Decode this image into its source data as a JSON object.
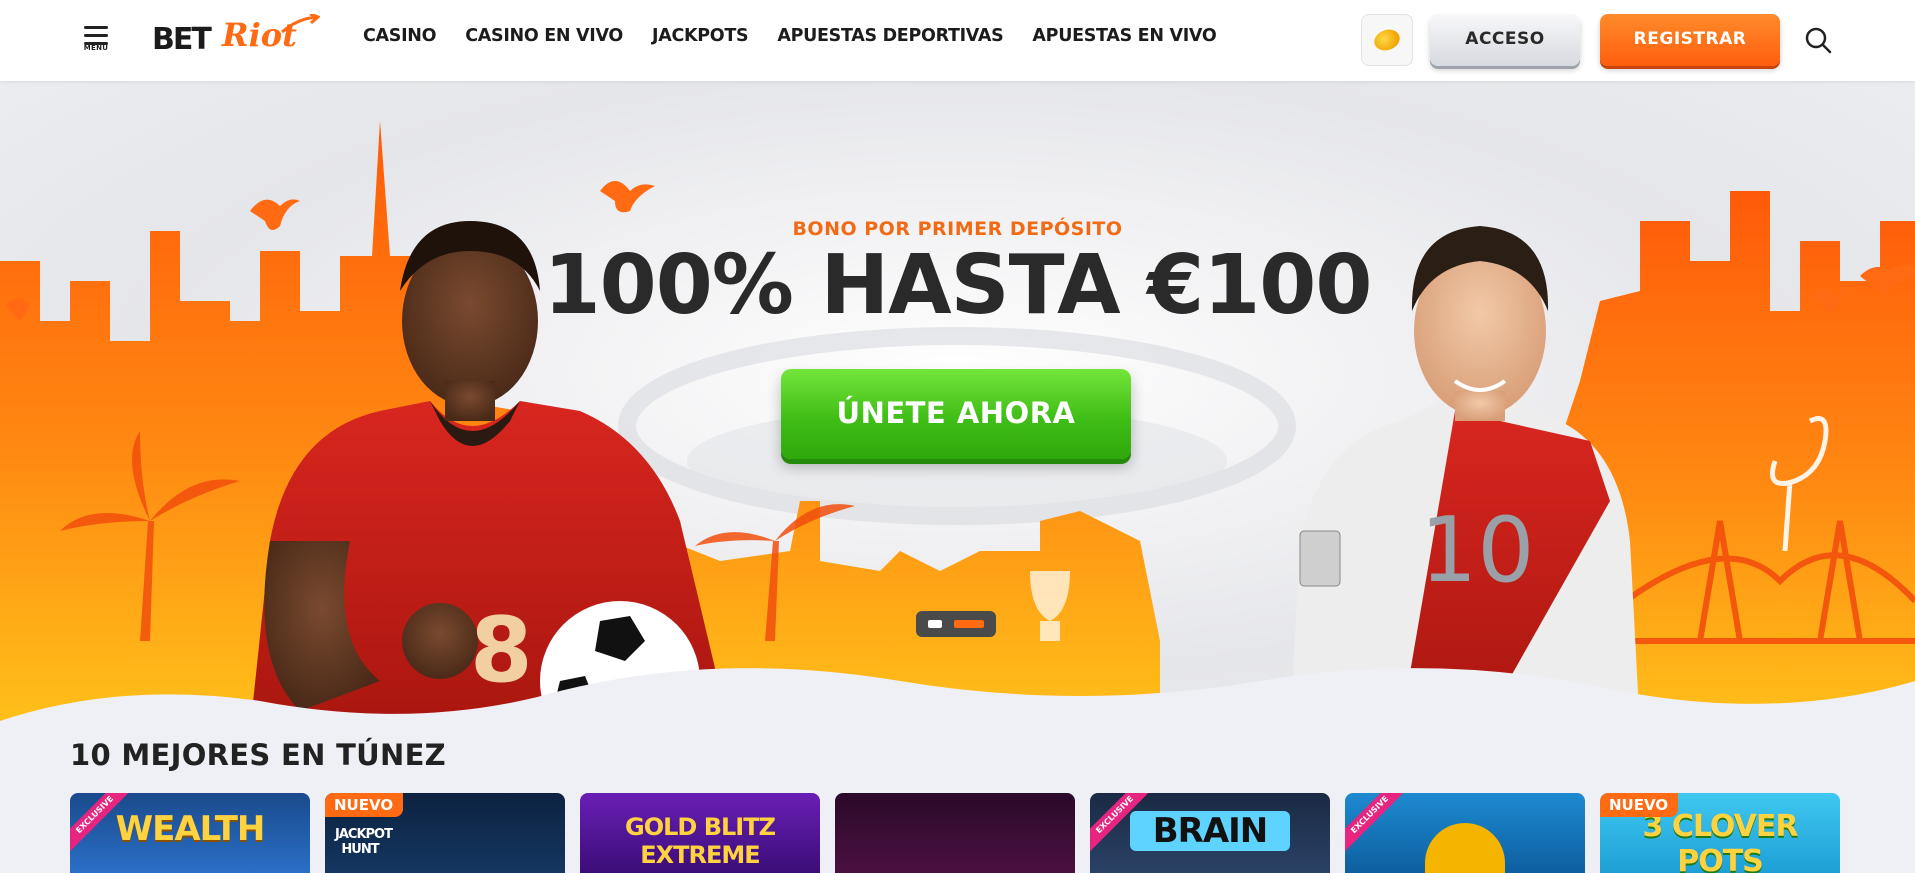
{
  "header": {
    "menu_label": "MENU",
    "logo_bet": "BET",
    "logo_riot": "Riot",
    "nav": [
      "CASINO",
      "CASINO EN VIVO",
      "JACKPOTS",
      "APUESTAS DEPORTIVAS",
      "APUESTAS EN VIVO"
    ],
    "login_label": "ACCESO",
    "register_label": "REGISTRAR"
  },
  "hero": {
    "subtitle": "BONO POR PRIMER DEPÓSITO",
    "title": "100% HASTA €100",
    "cta_label": "ÚNETE AHORA",
    "player_right_number": "10",
    "player_left_number": "8",
    "slides": 2,
    "active_slide": 2
  },
  "colors": {
    "brand_orange": "#ff6a13",
    "cta_green": "#3fbe17"
  },
  "section": {
    "title": "10 MEJORES EN TÚNEZ",
    "games": [
      {
        "title": "WEALTH",
        "badge": "EXCLUSIVE"
      },
      {
        "title": "JACKPOT HUNT",
        "badge": "NUEVO"
      },
      {
        "title": "GOLD BLITZ EXTREME",
        "badge": ""
      },
      {
        "title": "",
        "badge": ""
      },
      {
        "title": "BRAIN",
        "badge": "EXCLUSIVE"
      },
      {
        "title": "",
        "badge": "EXCLUSIVE"
      },
      {
        "title": "3 CLOVER POTS",
        "badge": "NUEVO"
      }
    ]
  }
}
